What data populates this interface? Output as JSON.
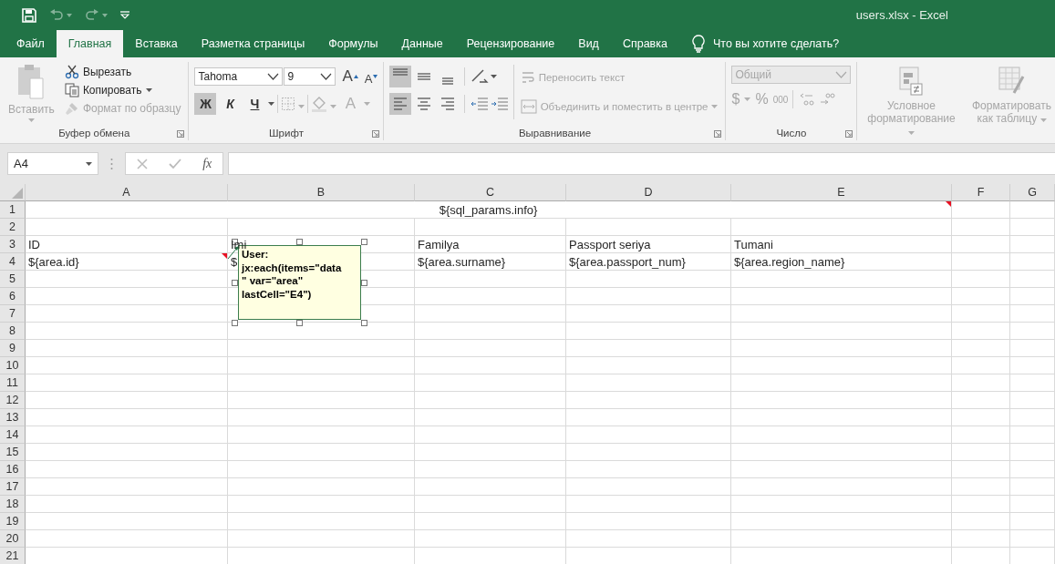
{
  "quick_access": [
    {
      "kind": "save",
      "disabled": false
    },
    {
      "kind": "undo",
      "disabled": true
    },
    {
      "kind": "redo",
      "disabled": true
    },
    {
      "kind": "customize",
      "disabled": false
    }
  ],
  "window": {
    "title": "users.xlsx  -  Excel"
  },
  "tabs": [
    {
      "label": "Файл",
      "selected": false
    },
    {
      "label": "Главная",
      "selected": true
    },
    {
      "label": "Вставка",
      "selected": false
    },
    {
      "label": "Разметка страницы",
      "selected": false
    },
    {
      "label": "Формулы",
      "selected": false
    },
    {
      "label": "Данные",
      "selected": false
    },
    {
      "label": "Рецензирование",
      "selected": false
    },
    {
      "label": "Вид",
      "selected": false
    },
    {
      "label": "Справка",
      "selected": false
    }
  ],
  "tell_me": {
    "label": "Что вы хотите сделать?"
  },
  "ribbon": {
    "clipboard": {
      "label": "Буфер обмена",
      "paste": {
        "label": "Вставить",
        "disabled": true
      },
      "cut": {
        "label": "Вырезать",
        "disabled": false
      },
      "copy": {
        "label": "Копировать",
        "disabled": false
      },
      "format_painter": {
        "label": "Формат по образцу",
        "disabled": true
      }
    },
    "font": {
      "label": "Шрифт",
      "font_name": "Tahoma",
      "font_size": "9",
      "grow": {
        "label": "A"
      },
      "shrink": {
        "label": "A"
      },
      "styles": [
        {
          "label": "Ж",
          "kind": "bold",
          "selected": true
        },
        {
          "label": "К",
          "kind": "italic",
          "selected": false
        },
        {
          "label": "Ч",
          "kind": "underline",
          "selected": false
        }
      ],
      "borders": {
        "disabled": true
      },
      "fill": {
        "disabled": true
      },
      "font_color": {
        "label": "A",
        "disabled": true
      }
    },
    "alignment": {
      "label": "Выравнивание",
      "vertical": [
        {
          "kind": "top",
          "selected": true
        },
        {
          "kind": "middle",
          "selected": false
        },
        {
          "kind": "bottom",
          "selected": false
        }
      ],
      "horizontal": [
        {
          "kind": "left",
          "selected": true
        },
        {
          "kind": "center",
          "selected": false
        },
        {
          "kind": "right",
          "selected": false
        }
      ],
      "wrap_text": {
        "label": "Переносить текст",
        "disabled": true
      },
      "merge": {
        "label": "Объединить и поместить в центре",
        "disabled": true
      }
    },
    "number": {
      "label": "Число",
      "format": {
        "value": "Общий",
        "disabled": true
      },
      "currency": {
        "label": "$"
      },
      "percent": {
        "label": "%"
      },
      "thousands": {
        "label": "000"
      }
    },
    "styles": {
      "conditional": {
        "label": "Условное форматирование",
        "disabled": true
      },
      "as_table": {
        "label": "Форматировать как таблицу",
        "disabled": true
      }
    }
  },
  "formula_bar": {
    "name_box": "A4",
    "function_label": "fx"
  },
  "sheet": {
    "columns": [
      "A",
      "B",
      "C",
      "D",
      "E",
      "F",
      "G"
    ],
    "rows": [
      {
        "label": "1",
        "merged": true,
        "cells": [
          {
            "text": "${sql_params.info}",
            "comment": true
          }
        ]
      },
      {
        "label": "2",
        "merged": false,
        "cells": []
      },
      {
        "label": "3",
        "merged": false,
        "cells": [
          {
            "text": "ID",
            "comment": false
          },
          {
            "text": "Imi",
            "comment": false
          },
          {
            "text": "Familya",
            "comment": false
          },
          {
            "text": "Passport seriya",
            "comment": false
          },
          {
            "text": "Tumani",
            "comment": false
          }
        ]
      },
      {
        "label": "4",
        "merged": false,
        "cells": [
          {
            "text": "${area.id}",
            "comment": true
          },
          {
            "text": "$",
            "comment": false
          },
          {
            "text": "${area.surname}",
            "comment": false
          },
          {
            "text": "${area.passport_num}",
            "comment": false
          },
          {
            "text": "${area.region_name}",
            "comment": false
          }
        ]
      },
      {
        "label": "5",
        "merged": false
      },
      {
        "label": "6",
        "merged": false
      },
      {
        "label": "7",
        "merged": false
      },
      {
        "label": "8",
        "merged": false
      },
      {
        "label": "9",
        "merged": false
      },
      {
        "label": "10",
        "merged": false
      },
      {
        "label": "11",
        "merged": false
      },
      {
        "label": "12",
        "merged": false
      },
      {
        "label": "13",
        "merged": false
      },
      {
        "label": "14",
        "merged": false
      },
      {
        "label": "15",
        "merged": false
      },
      {
        "label": "16",
        "merged": false
      },
      {
        "label": "17",
        "merged": false
      },
      {
        "label": "18",
        "merged": false
      },
      {
        "label": "19",
        "merged": false
      },
      {
        "label": "20",
        "merged": false
      },
      {
        "label": "21",
        "merged": false
      }
    ],
    "comment": {
      "author": "User:",
      "lines": [
        "jx:each(items=\"data",
        "\" var=\"area\"",
        "lastCell=\"E4\")"
      ]
    }
  }
}
